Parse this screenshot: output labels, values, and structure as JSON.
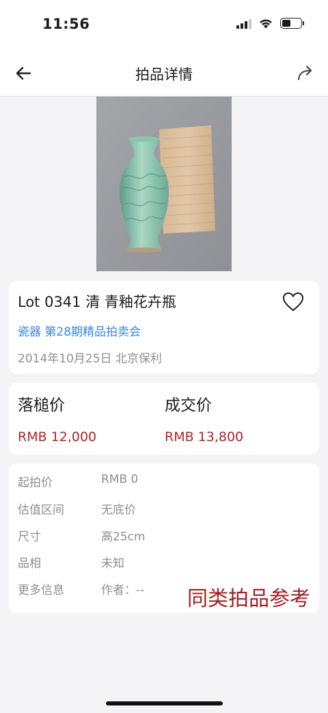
{
  "status_bar": {
    "time": "11:56",
    "battery_level": 0.45
  },
  "nav": {
    "title": "拍品详情",
    "back_icon": "arrow-left-icon",
    "share_icon": "share-forward-icon"
  },
  "hero": {
    "image": "celadon-vase-with-wooden-box"
  },
  "lot": {
    "title": "Lot 0341 清 青釉花卉瓶",
    "category_session": "瓷器 第28期精品拍卖会",
    "date_house": "2014年10月25日 北京保利",
    "favorite_icon": "heart-outline-icon"
  },
  "prices": {
    "hammer_label": "落槌价",
    "hammer_value": "RMB 12,000",
    "deal_label": "成交价",
    "deal_value": "RMB 13,800",
    "accent_color": "#a9262b"
  },
  "details": [
    {
      "key": "起拍价",
      "value": "RMB 0"
    },
    {
      "key": "估值区间",
      "value": "无底价"
    },
    {
      "key": "尺寸",
      "value": "高25cm"
    },
    {
      "key": "品相",
      "value": "未知"
    },
    {
      "key": "更多信息",
      "value": "作者：--"
    }
  ],
  "similar_button": "同类拍品参考"
}
